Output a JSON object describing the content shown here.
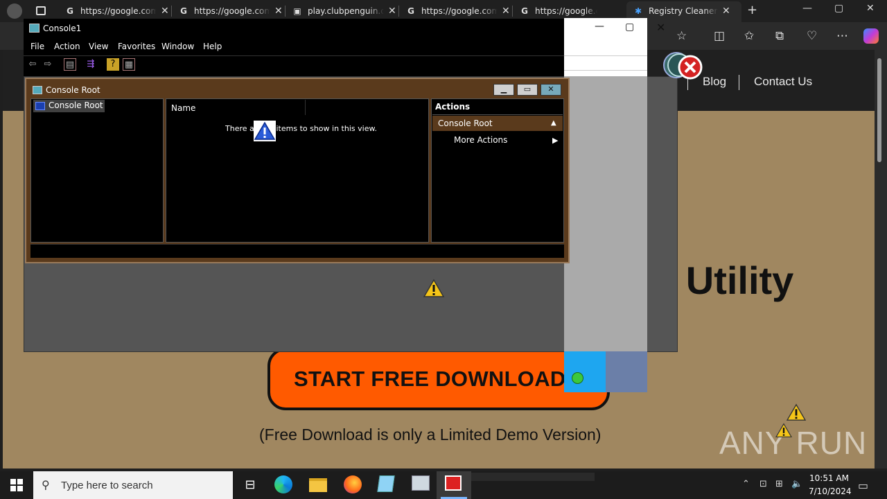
{
  "browser": {
    "tabs": [
      {
        "label": "https://google.com",
        "icon": "google-icon"
      },
      {
        "label": "https://google.com",
        "icon": "google-icon"
      },
      {
        "label": "play.clubpenguin.com",
        "icon": "page-icon"
      },
      {
        "label": "https://google.com",
        "icon": "google-icon"
      },
      {
        "label": "https://google.com",
        "icon": "google-icon"
      },
      {
        "label": "Registry Cleaner To",
        "icon": "site-icon"
      }
    ],
    "new_tab": "+",
    "window_controls": {
      "minimize": "—",
      "maximize": "▢",
      "close": "✕"
    }
  },
  "site": {
    "nav": {
      "blog": "Blog",
      "contact": "Contact Us"
    },
    "hero_title": "n Utility",
    "download_button": "START FREE DOWNLOAD",
    "download_note": "(Free Download is only a Limited Demo Version)",
    "watermark": "ANY RUN"
  },
  "mmc": {
    "title": "Console1",
    "menu": [
      "File",
      "Action",
      "View",
      "Favorites",
      "Window",
      "Help"
    ],
    "child_title": "Console Root",
    "tree_item": "Console Root",
    "column_name": "Name",
    "empty_message": "There are no items to show in this view.",
    "actions_header": "Actions",
    "actions_section": "Console Root",
    "more_actions": "More Actions"
  },
  "overlay_window": {
    "minimize": "—",
    "maximize": "▢",
    "close": "✕"
  },
  "taskbar": {
    "search_placeholder": "Type here to search",
    "time": "10:51 AM",
    "date": "7/10/2024"
  },
  "colors": {
    "site_body": "#a08760",
    "download_button": "#ff5a00",
    "mmc_brown": "#5a3a1c"
  }
}
